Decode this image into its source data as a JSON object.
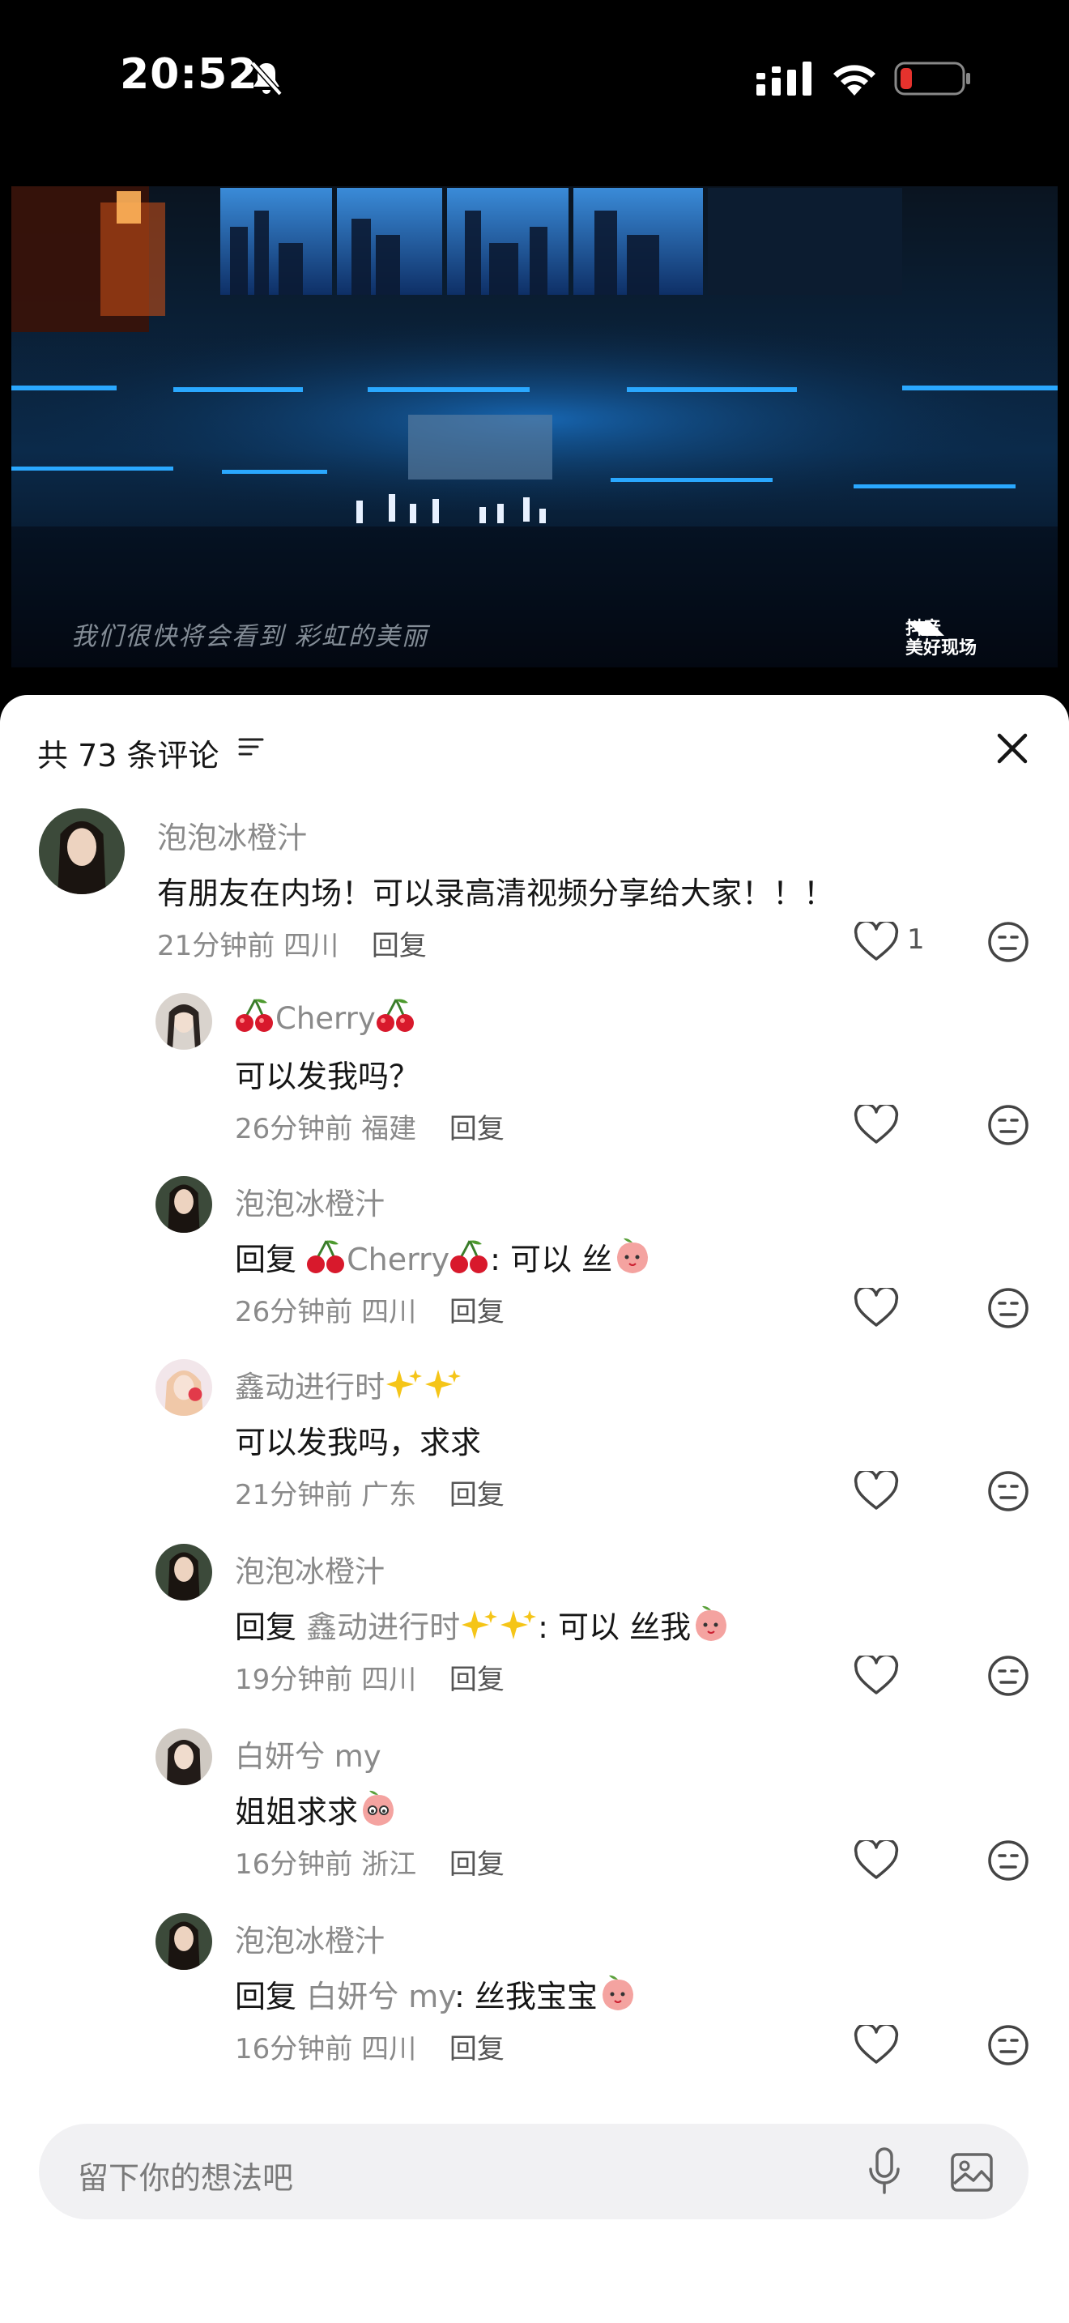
{
  "status": {
    "time": "20:52"
  },
  "video": {
    "subtitle": "我们很快将会看到 彩虹的美丽",
    "watermark_line1": "抖音",
    "watermark_line2": "美好现场"
  },
  "comments_header": {
    "title": "共 73 条评论"
  },
  "comments": [
    {
      "name": "泡泡冰橙汁",
      "text": "有朋友在内场！可以录高清视频分享给大家！！！",
      "time": "21分钟前",
      "location": "四川",
      "reply": "回复",
      "likes": "1"
    },
    {
      "name": "Cherry",
      "text": "可以发我吗？",
      "time": "26分钟前",
      "location": "福建",
      "reply": "回复"
    },
    {
      "name": "泡泡冰橙汁",
      "prefix": "回复",
      "ref": "Cherry",
      "text": ": 可以 丝",
      "time": "26分钟前",
      "location": "四川",
      "reply": "回复"
    },
    {
      "name": "鑫动进行时",
      "text": "可以发我吗，求求",
      "time": "21分钟前",
      "location": "广东",
      "reply": "回复"
    },
    {
      "name": "泡泡冰橙汁",
      "prefix": "回复",
      "ref": "鑫动进行时",
      "text": ": 可以 丝我",
      "time": "19分钟前",
      "location": "四川",
      "reply": "回复"
    },
    {
      "name": "白妍兮 my",
      "text": "姐姐求求",
      "time": "16分钟前",
      "location": "浙江",
      "reply": "回复"
    },
    {
      "name": "泡泡冰橙汁",
      "prefix": "回复",
      "ref": "白妍兮 my",
      "text": ": 丝我宝宝",
      "time": "16分钟前",
      "location": "四川",
      "reply": "回复"
    }
  ],
  "input": {
    "placeholder": "留下你的想法吧"
  },
  "icons": [
    "bell-slash-icon",
    "signal-icon",
    "wifi-icon",
    "battery-icon",
    "filter-icon",
    "close-icon",
    "heart-icon",
    "dislike-face-icon",
    "cherry-icon",
    "sparkle-icon",
    "peach-emoji-icon",
    "microphone-icon",
    "image-icon"
  ],
  "colors": {
    "battery_low": "#e5322d",
    "text_primary": "#161616",
    "text_secondary": "#8a8a8a",
    "input_bg": "#f1f1f3"
  }
}
